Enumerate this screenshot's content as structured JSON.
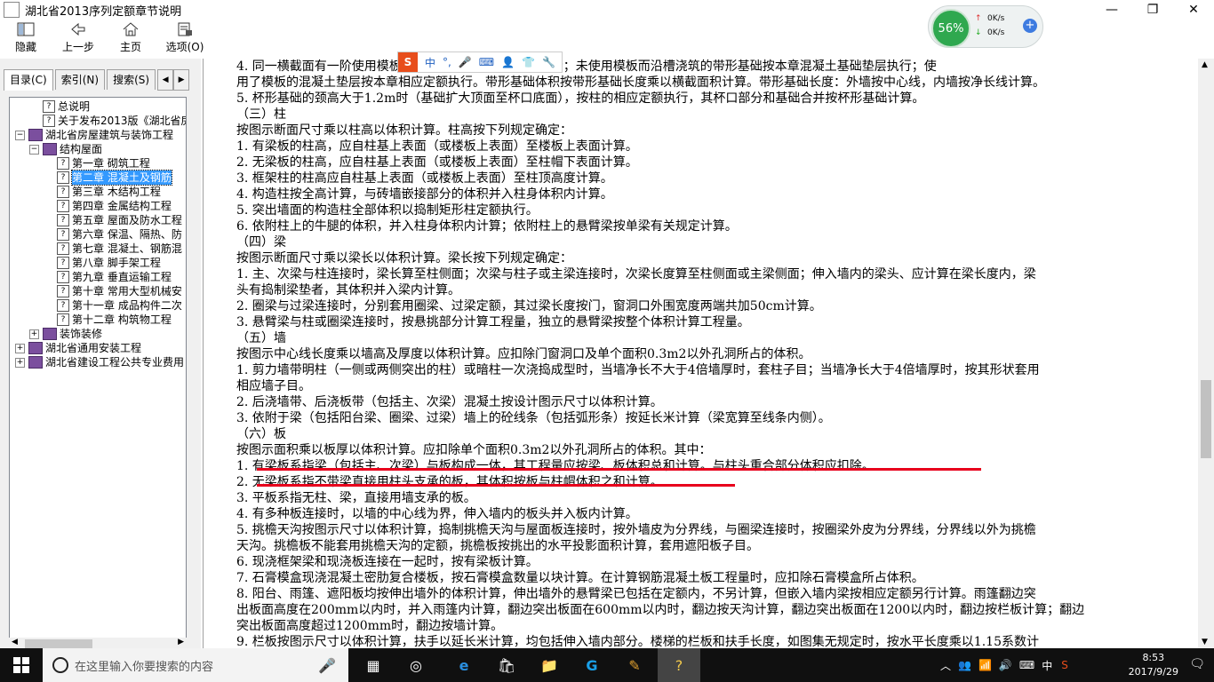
{
  "window": {
    "title": "湖北省2013序列定额章节说明",
    "controls": [
      "minimize",
      "restore",
      "close"
    ]
  },
  "toolbar": {
    "items": [
      {
        "label": "隐藏",
        "icon": "hide-icon"
      },
      {
        "label": "上一步",
        "icon": "back-icon"
      },
      {
        "label": "主页",
        "icon": "home-icon"
      },
      {
        "label": "选项(O)",
        "icon": "options-icon"
      }
    ]
  },
  "net_widget": {
    "percent": "56%",
    "up": "0K/s",
    "down": "0K/s"
  },
  "ime_bar": {
    "lang": "中"
  },
  "left_panel": {
    "tabs": [
      "目录(C)",
      "索引(N)",
      "搜索(S)"
    ],
    "tree": [
      {
        "label": "总说明",
        "icon": "help-page-icon",
        "level": 1,
        "expander": ""
      },
      {
        "label": "关于发布2013版《湖北省房屋",
        "icon": "help-page-icon",
        "level": 1,
        "expander": ""
      },
      {
        "label": "湖北省房屋建筑与装饰工程",
        "icon": "book-icon",
        "level": 0,
        "expander": "−"
      },
      {
        "label": "结构屋面",
        "icon": "book-icon",
        "level": 1,
        "expander": "−"
      },
      {
        "label": "第一章  砌筑工程",
        "icon": "help-page-icon",
        "level": 2,
        "expander": ""
      },
      {
        "label": "第二章  混凝土及钢筋",
        "icon": "help-page-icon",
        "level": 2,
        "expander": "",
        "selected": true
      },
      {
        "label": "第三章  木结构工程",
        "icon": "help-page-icon",
        "level": 2,
        "expander": ""
      },
      {
        "label": "第四章  金属结构工程",
        "icon": "help-page-icon",
        "level": 2,
        "expander": ""
      },
      {
        "label": "第五章  屋面及防水工程",
        "icon": "help-page-icon",
        "level": 2,
        "expander": ""
      },
      {
        "label": "第六章  保温、隔热、防",
        "icon": "help-page-icon",
        "level": 2,
        "expander": ""
      },
      {
        "label": "第七章  混凝土、钢筋混",
        "icon": "help-page-icon",
        "level": 2,
        "expander": ""
      },
      {
        "label": "第八章  脚手架工程",
        "icon": "help-page-icon",
        "level": 2,
        "expander": ""
      },
      {
        "label": "第九章  垂直运输工程",
        "icon": "help-page-icon",
        "level": 2,
        "expander": ""
      },
      {
        "label": "第十章  常用大型机械安",
        "icon": "help-page-icon",
        "level": 2,
        "expander": ""
      },
      {
        "label": "第十一章  成品构件二次",
        "icon": "help-page-icon",
        "level": 2,
        "expander": ""
      },
      {
        "label": "第十二章  构筑物工程",
        "icon": "help-page-icon",
        "level": 2,
        "expander": ""
      },
      {
        "label": "装饰装修",
        "icon": "book-icon",
        "level": 1,
        "expander": "+"
      },
      {
        "label": "湖北省通用安装工程",
        "icon": "book-icon",
        "level": 0,
        "expander": "+"
      },
      {
        "label": "湖北省建设工程公共专业费用",
        "icon": "book-icon",
        "level": 0,
        "expander": "+"
      }
    ]
  },
  "content": {
    "lines": [
      "4. 同一横截面有一阶使用模板的带形基础相应定额项目执行；未使用模板而沿槽浇筑的带形基础按本章混凝土基础垫层执行；使",
      "用了模板的混凝土垫层按本章相应定额执行。带形基础体积按带形基础长度乘以横截面积计算。带形基础长度：外墙按中心线，内墙按净长线计算。",
      "5. 杯形基础的颈高大于1.2m时（基础扩大顶面至杯口底面），按柱的相应定额执行，其杯口部分和基础合并按杯形基础计算。",
      "（三）柱",
      "按图示断面尺寸乘以柱高以体积计算。柱高按下列规定确定：",
      "1. 有梁板的柱高，应自柱基上表面（或楼板上表面）至楼板上表面计算。",
      "2. 无梁板的柱高，应自柱基上表面（或楼板上表面）至柱帽下表面计算。",
      "3. 框架柱的柱高应自柱基上表面（或楼板上表面）至柱顶高度计算。",
      "4. 构造柱按全高计算，与砖墙嵌接部分的体积并入柱身体积内计算。",
      "5. 突出墙面的构造柱全部体积以捣制矩形柱定额执行。",
      "6. 依附柱上的牛腿的体积，并入柱身体积内计算；依附柱上的悬臂梁按单梁有关规定计算。",
      "（四）梁",
      "按图示断面尺寸乘以梁长以体积计算。梁长按下列规定确定：",
      "1. 主、次梁与柱连接时，梁长算至柱侧面；次梁与柱子或主梁连接时，次梁长度算至柱侧面或主梁侧面；伸入墙内的梁头、应计算在梁长度内，梁",
      "头有捣制梁垫者，其体积并入梁内计算。",
      "2. 圈梁与过梁连接时，分别套用圈梁、过梁定额，其过梁长度按门，窗洞口外围宽度两端共加50cm计算。",
      "3. 悬臂梁与柱或圈梁连接时，按悬挑部分计算工程量，独立的悬臂梁按整个体积计算工程量。",
      "（五）墙",
      "按图示中心线长度乘以墙高及厚度以体积计算。应扣除门窗洞口及单个面积0.3m2以外孔洞所占的体积。",
      "1. 剪力墙带明柱（一侧或两侧突出的柱）或暗柱一次浇捣成型时，当墙净长不大于4倍墙厚时，套柱子目；当墙净长大于4倍墙厚时，按其形状套用",
      "相应墙子目。",
      "2. 后浇墙带、后浇板带（包括主、次梁）混凝土按设计图示尺寸以体积计算。",
      "3. 依附于梁（包括阳台梁、圈梁、过梁）墙上的砼线条（包括弧形条）按延长米计算（梁宽算至线条内侧）。",
      "（六）板",
      "按图示面积乘以板厚以体积计算。应扣除单个面积0.3m2以外孔洞所占的体积。其中：",
      "1. 有梁板系指梁（包括主、次梁）与板构成一体，其工程量应按梁、板体积总和计算。与柱头重合部分体积应扣除。",
      "2. 无梁板系指不带梁直接用柱头支承的板，其体积按板与柱帽体积之和计算。",
      "3. 平板系指无柱、梁，直接用墙支承的板。",
      "4. 有多种板连接时，以墙的中心线为界，伸入墙内的板头并入板内计算。",
      "5. 挑檐天沟按图示尺寸以体积计算，捣制挑檐天沟与屋面板连接时，按外墙皮为分界线，与圈梁连接时，按圈梁外皮为分界线，分界线以外为挑檐",
      "天沟。挑檐板不能套用挑檐天沟的定额，挑檐板按挑出的水平投影面积计算，套用遮阳板子目。",
      "6. 现浇框架梁和现浇板连接在一起时，按有梁板计算。",
      "7. 石膏模盒现浇混凝土密肋复合楼板，按石膏模盒数量以块计算。在计算钢筋混凝土板工程量时，应扣除石膏模盒所占体积。",
      "8. 阳台、雨篷、遮阳板均按伸出墙外的体积计算，伸出墙外的悬臂梁已包括在定额内，不另计算，但嵌入墙内梁按相应定额另行计算。雨篷翻边突",
      "出板面高度在200mm以内时，并入雨篷内计算，翻边突出板面在600mm以内时，翻边按天沟计算，翻边突出板面在1200以内时，翻边按栏板计算；翻边",
      "突出板面高度超过1200mm时，翻边按墙计算。",
      "9. 栏板按图示尺寸以体积计算，扶手以延长米计算，均包括伸入墙内部分。楼梯的栏板和扶手长度，如图集无规定时，按水平长度乘以1.15系数计"
    ]
  },
  "taskbar": {
    "search_placeholder": "在这里输入你要搜索的内容",
    "apps": [
      "task-view",
      "browser-360",
      "edge",
      "store",
      "explorer",
      "g-app",
      "notes-app",
      "help-app"
    ],
    "ime": "中",
    "time": "8:53",
    "date": "2017/9/29"
  },
  "colors": {
    "selection": "#3399ff",
    "annotation": "#e8001c",
    "taskbar": "#101010"
  }
}
